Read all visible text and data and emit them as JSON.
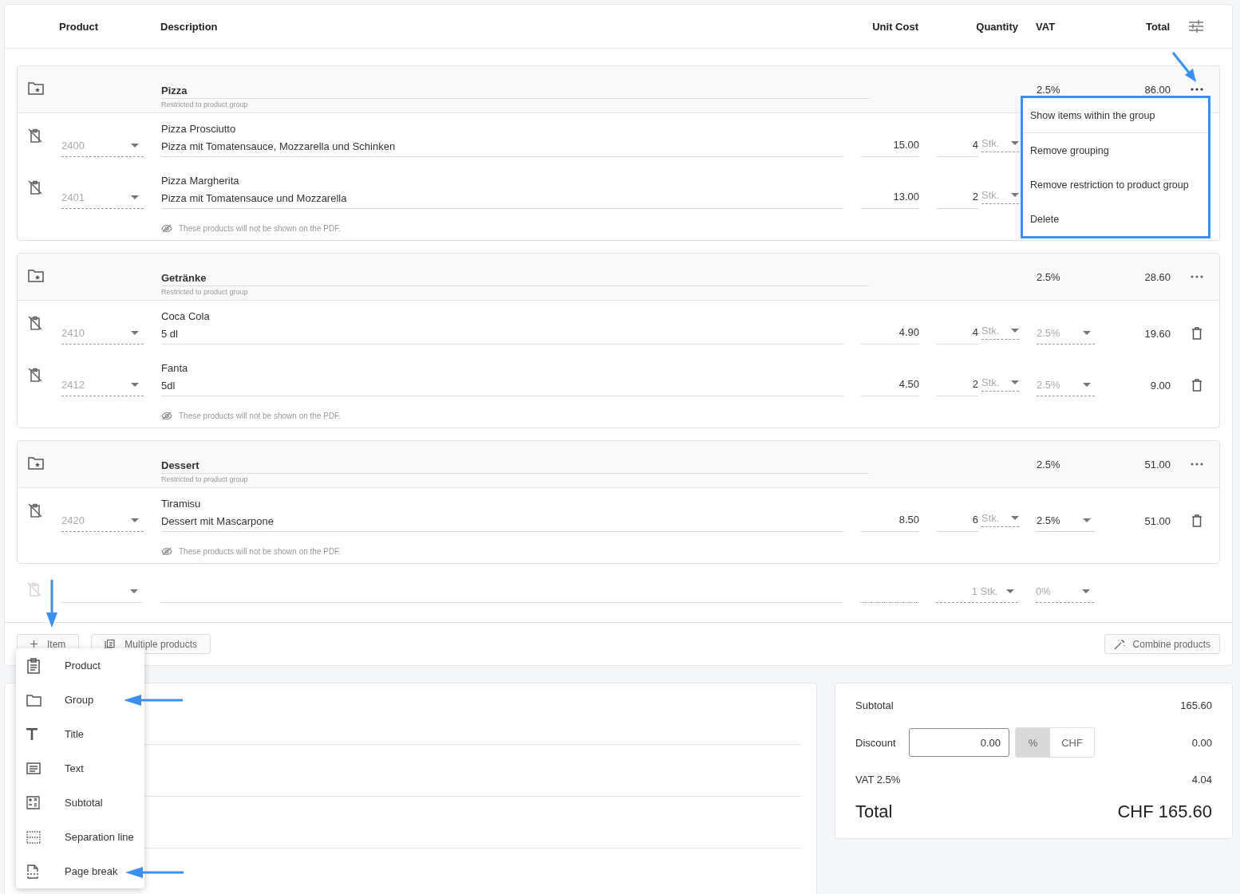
{
  "columns": [
    "Product",
    "Description",
    "Unit Cost",
    "Quantity",
    "VAT",
    "Total"
  ],
  "groups": [
    {
      "name": "Pizza",
      "restriction": "Restricted to product group",
      "vat": "2.5%",
      "total": "86.00",
      "menu_open": true,
      "note": "These products will not be shown on the PDF.",
      "items": [
        {
          "number": "2400",
          "name": "Pizza Prosciutto",
          "description": "Pizza mit Tomatensauce, Mozzarella und Schinken",
          "unit_cost": "15.00",
          "quantity": "4",
          "unit": "Stk."
        },
        {
          "number": "2401",
          "name": "Pizza Margherita",
          "description": "Pizza mit Tomatensauce und Mozzarella",
          "unit_cost": "13.00",
          "quantity": "2",
          "unit": "Stk."
        }
      ]
    },
    {
      "name": "Getränke",
      "restriction": "Restricted to product group",
      "vat": "2.5%",
      "total": "28.60",
      "menu_open": false,
      "note": "These products will not be shown on the PDF.",
      "items": [
        {
          "number": "2410",
          "name": "Coca Cola",
          "description": "5 dl",
          "unit_cost": "4.90",
          "quantity": "4",
          "unit": "Stk.",
          "vat": "2.5%",
          "vat_inherited": true,
          "total": "19.60"
        },
        {
          "number": "2412",
          "name": "Fanta",
          "description": "5dl",
          "unit_cost": "4.50",
          "quantity": "2",
          "unit": "Stk.",
          "vat": "2.5%",
          "vat_inherited": true,
          "total": "9.00"
        }
      ]
    },
    {
      "name": "Dessert",
      "restriction": "Restricted to product group",
      "vat": "2.5%",
      "total": "51.00",
      "menu_open": false,
      "note": "These products will not be shown on the PDF.",
      "items": [
        {
          "number": "2420",
          "name": "Tiramisu",
          "description": "Dessert mit Mascarpone",
          "unit_cost": "8.50",
          "quantity": "6",
          "unit": "Stk.",
          "vat": "2.5%",
          "vat_inherited": false,
          "total": "51.00"
        }
      ]
    }
  ],
  "group_menu": [
    "Show items within the group",
    "Remove grouping",
    "Remove restriction to product group",
    "Delete"
  ],
  "new_row": {
    "quantity": "1",
    "unit": "Stk.",
    "vat": "0%"
  },
  "toolbar": {
    "add_item": "Item",
    "multiple_products": "Multiple products",
    "combine_products": "Combine products"
  },
  "add_menu": {
    "open": true,
    "items": [
      {
        "label": "Product",
        "kind": "product"
      },
      {
        "label": "Group",
        "kind": "group"
      },
      {
        "label": "Title",
        "kind": "title"
      },
      {
        "label": "Text",
        "kind": "text"
      },
      {
        "label": "Subtotal",
        "kind": "subtotal"
      },
      {
        "label": "Separation line",
        "kind": "separator"
      },
      {
        "label": "Page break",
        "kind": "pagebreak"
      }
    ]
  },
  "summary": {
    "subtotal_label": "Subtotal",
    "subtotal": "165.60",
    "discount_label": "Discount",
    "discount_input": "0.00",
    "discount_modes": [
      {
        "label": "%",
        "selected": true
      },
      {
        "label": "CHF",
        "selected": false
      }
    ],
    "discount": "0.00",
    "vat_label": "VAT 2.5%",
    "vat": "4.04",
    "total_label": "Total",
    "total": "CHF 165.60"
  }
}
